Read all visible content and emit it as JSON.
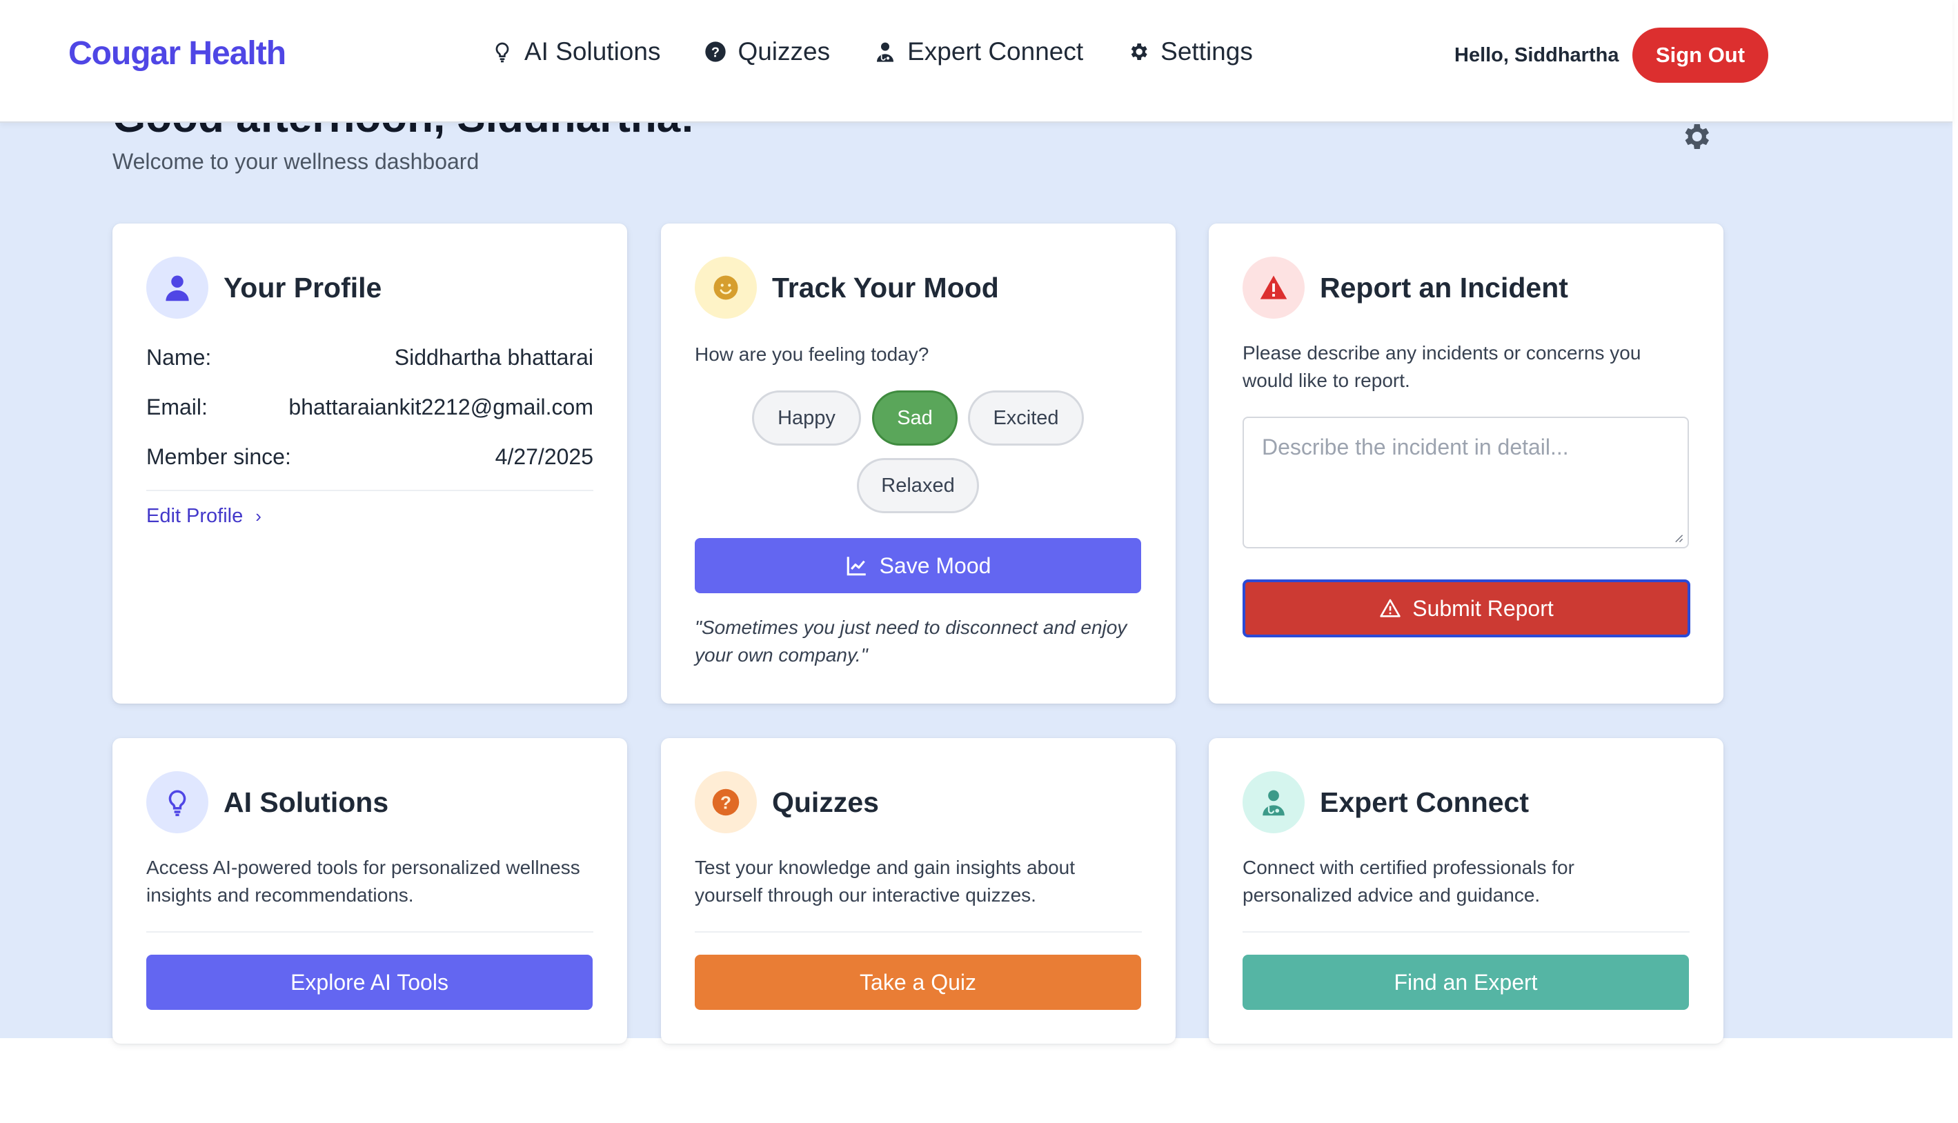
{
  "navbar": {
    "brand": "Cougar Health",
    "links": [
      {
        "label": "AI Solutions",
        "icon": "lightbulb-icon"
      },
      {
        "label": "Quizzes",
        "icon": "question-circle-icon"
      },
      {
        "label": "Expert Connect",
        "icon": "doctor-icon"
      },
      {
        "label": "Settings",
        "icon": "gear-icon"
      }
    ],
    "greeting": "Hello, Siddhartha",
    "sign_out": "Sign Out"
  },
  "hero": {
    "title": "Good afternoon, Siddhartha!",
    "subtitle": "Welcome to your wellness dashboard"
  },
  "profile": {
    "title": "Your Profile",
    "rows": [
      {
        "label": "Name:",
        "value": "Siddhartha bhattarai"
      },
      {
        "label": "Email:",
        "value": "bhattaraiankit2212@gmail.com"
      },
      {
        "label": "Member since:",
        "value": "4/27/2025"
      }
    ],
    "edit_label": "Edit Profile"
  },
  "mood": {
    "title": "Track Your Mood",
    "prompt": "How are you feeling today?",
    "options": [
      "Happy",
      "Sad",
      "Excited",
      "Relaxed"
    ],
    "selected": "Sad",
    "save_label": "Save Mood",
    "quote": "\"Sometimes you just need to disconnect and enjoy your own company.\""
  },
  "incident": {
    "title": "Report an Incident",
    "description": "Please describe any incidents or concerns you would like to report.",
    "placeholder": "Describe the incident in detail...",
    "submit_label": "Submit Report"
  },
  "ai": {
    "title": "AI Solutions",
    "description": "Access AI-powered tools for personalized wellness insights and recommendations.",
    "button": "Explore AI Tools"
  },
  "quizzes": {
    "title": "Quizzes",
    "description": "Test your knowledge and gain insights about yourself through our interactive quizzes.",
    "button": "Take a Quiz"
  },
  "expert": {
    "title": "Expert Connect",
    "description": "Connect with certified professionals for personalized advice and guidance.",
    "button": "Find an Expert"
  },
  "colors": {
    "brand": "#4f46e5",
    "sign_out": "#dc2f2f",
    "primary": "#6366f1",
    "mood_selected": "#5aa65a",
    "submit": "#cc3a33",
    "quiz": "#e97d35",
    "expert": "#55b5a4",
    "background": "#dfe9fa"
  }
}
